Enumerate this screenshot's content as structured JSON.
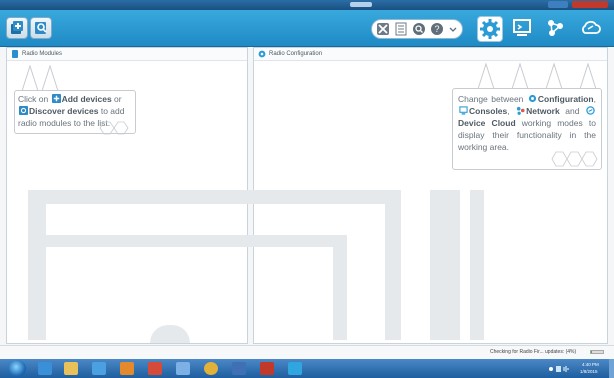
{
  "toolbar": {
    "add_devices_icon": "add-device-icon",
    "discover_devices_icon": "discover-device-icon",
    "tools": [
      "tools-icon",
      "console-log-icon",
      "search-icon",
      "help-icon"
    ],
    "modes": [
      "configuration-icon",
      "consoles-icon",
      "network-icon",
      "device-cloud-icon"
    ],
    "accent": "#2a9bd6"
  },
  "left_panel": {
    "title": "Radio Modules",
    "callout": {
      "t1": "Click on ",
      "add_devices": "Add devices",
      "t2": " or",
      "discover_devices": "Discover devices",
      "t3": " to add radio modules to the list."
    }
  },
  "right_panel": {
    "title": "Radio Configuration",
    "callout": {
      "t1": "Change between ",
      "configuration": "Configuration",
      "t2": ", ",
      "consoles": "Consoles",
      "t3": ", ",
      "network": "Network",
      "t4": " and ",
      "device_cloud": "Device Cloud",
      "t5": " working modes to display their functionality in the working area."
    }
  },
  "status": {
    "text": "Checking for Radio Fir... updates: (4%)",
    "progress": 0.04
  },
  "taskbar": {
    "time": "4:40 PM",
    "date": "1/8/2015"
  }
}
